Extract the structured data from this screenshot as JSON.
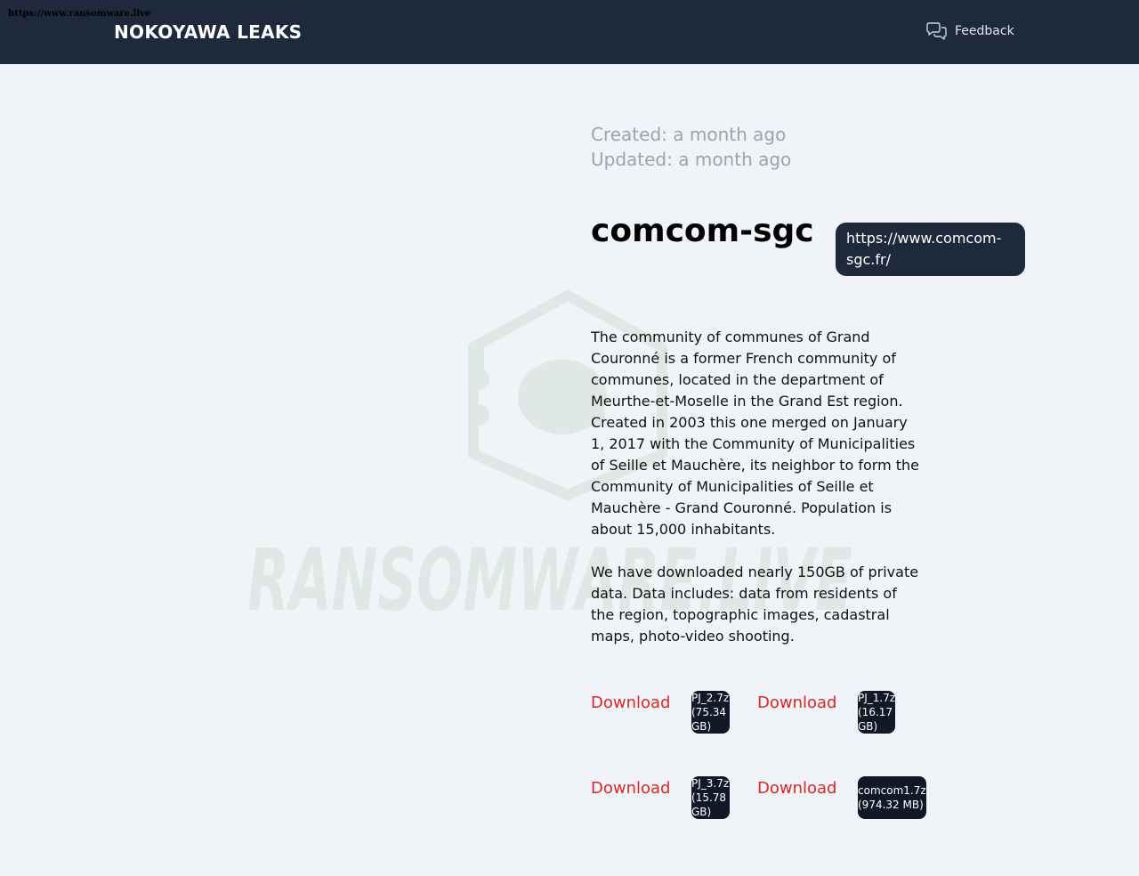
{
  "source_url": "https://www.ransomware.live",
  "header": {
    "brand": "NOKOYAWA LEAKS",
    "feedback_label": "Feedback",
    "feedback_icon": "chat-bubbles-icon"
  },
  "watermark": {
    "text": "RANSOMWARE.LIVE",
    "icon": "ransomware-live-logo-icon"
  },
  "post": {
    "created": "Created: a month ago",
    "updated": "Updated: a month ago",
    "title": "comcom-sgc",
    "website": "https://www.comcom-sgc.fr/",
    "description": [
      "The community of communes of Grand Couronné is a former French community of communes, located in the department of Meurthe-et-Moselle in the Grand Est region. Created in 2003 this one merged on January 1, 2017 with the Community of Municipalities of Seille et Mauchère, its neighbor to form the Community of Municipalities of Seille et Mauchère - Grand Couronné. Population is about 15,000 inhabitants.",
      "We have downloaded nearly 150GB of private data. Data includes: data from residents of the region, topographic images, cadastral maps, photo-video shooting."
    ],
    "downloads": [
      {
        "label": "Download",
        "file": "PJ_2.7z (75.34 GB)"
      },
      {
        "label": "Download",
        "file": "PJ_1.7z (16.17 GB)"
      },
      {
        "label": "Download",
        "file": "PJ_3.7z (15.78 GB)"
      },
      {
        "label": "Download",
        "file": "comcom1.7z (974.32 MB)"
      }
    ]
  },
  "colors": {
    "header_bg": "#1e293b",
    "page_bg": "#f0f4f8",
    "download_link": "#dc2626",
    "badge_bg": "#111827",
    "muted_text": "#9ca3af"
  }
}
